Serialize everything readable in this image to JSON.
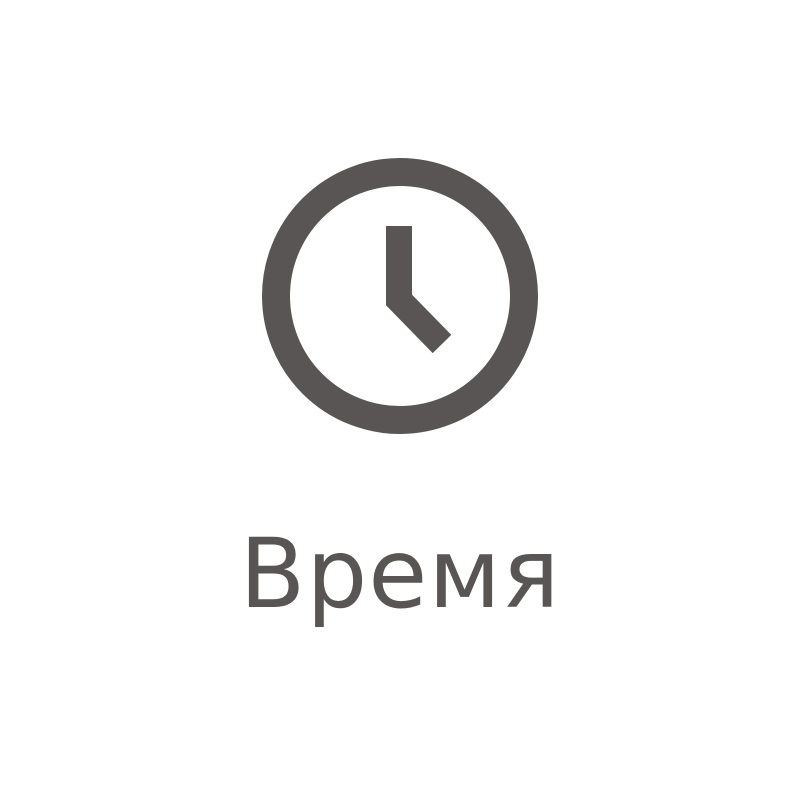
{
  "tile": {
    "icon": "clock-icon",
    "label": "Время",
    "color": "#5a5555",
    "background": "#ffffff"
  }
}
